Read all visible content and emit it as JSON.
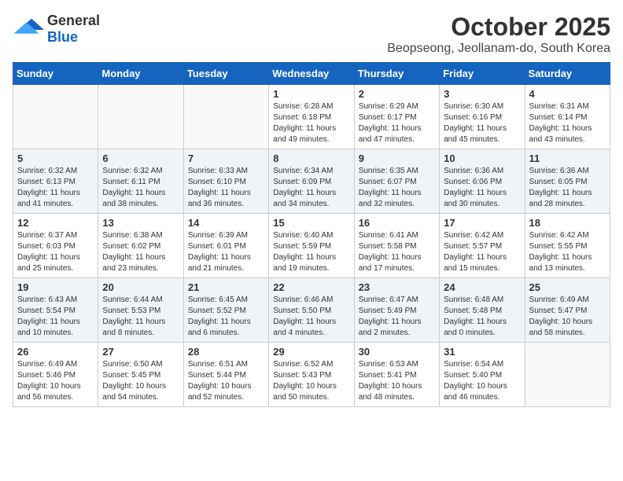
{
  "header": {
    "logo_general": "General",
    "logo_blue": "Blue",
    "month_title": "October 2025",
    "location": "Beopseong, Jeollanam-do, South Korea"
  },
  "days_of_week": [
    "Sunday",
    "Monday",
    "Tuesday",
    "Wednesday",
    "Thursday",
    "Friday",
    "Saturday"
  ],
  "weeks": [
    {
      "shaded": false,
      "days": [
        {
          "number": "",
          "info": ""
        },
        {
          "number": "",
          "info": ""
        },
        {
          "number": "",
          "info": ""
        },
        {
          "number": "1",
          "info": "Sunrise: 6:28 AM\nSunset: 6:18 PM\nDaylight: 11 hours\nand 49 minutes."
        },
        {
          "number": "2",
          "info": "Sunrise: 6:29 AM\nSunset: 6:17 PM\nDaylight: 11 hours\nand 47 minutes."
        },
        {
          "number": "3",
          "info": "Sunrise: 6:30 AM\nSunset: 6:16 PM\nDaylight: 11 hours\nand 45 minutes."
        },
        {
          "number": "4",
          "info": "Sunrise: 6:31 AM\nSunset: 6:14 PM\nDaylight: 11 hours\nand 43 minutes."
        }
      ]
    },
    {
      "shaded": true,
      "days": [
        {
          "number": "5",
          "info": "Sunrise: 6:32 AM\nSunset: 6:13 PM\nDaylight: 11 hours\nand 41 minutes."
        },
        {
          "number": "6",
          "info": "Sunrise: 6:32 AM\nSunset: 6:11 PM\nDaylight: 11 hours\nand 38 minutes."
        },
        {
          "number": "7",
          "info": "Sunrise: 6:33 AM\nSunset: 6:10 PM\nDaylight: 11 hours\nand 36 minutes."
        },
        {
          "number": "8",
          "info": "Sunrise: 6:34 AM\nSunset: 6:09 PM\nDaylight: 11 hours\nand 34 minutes."
        },
        {
          "number": "9",
          "info": "Sunrise: 6:35 AM\nSunset: 6:07 PM\nDaylight: 11 hours\nand 32 minutes."
        },
        {
          "number": "10",
          "info": "Sunrise: 6:36 AM\nSunset: 6:06 PM\nDaylight: 11 hours\nand 30 minutes."
        },
        {
          "number": "11",
          "info": "Sunrise: 6:36 AM\nSunset: 6:05 PM\nDaylight: 11 hours\nand 28 minutes."
        }
      ]
    },
    {
      "shaded": false,
      "days": [
        {
          "number": "12",
          "info": "Sunrise: 6:37 AM\nSunset: 6:03 PM\nDaylight: 11 hours\nand 25 minutes."
        },
        {
          "number": "13",
          "info": "Sunrise: 6:38 AM\nSunset: 6:02 PM\nDaylight: 11 hours\nand 23 minutes."
        },
        {
          "number": "14",
          "info": "Sunrise: 6:39 AM\nSunset: 6:01 PM\nDaylight: 11 hours\nand 21 minutes."
        },
        {
          "number": "15",
          "info": "Sunrise: 6:40 AM\nSunset: 5:59 PM\nDaylight: 11 hours\nand 19 minutes."
        },
        {
          "number": "16",
          "info": "Sunrise: 6:41 AM\nSunset: 5:58 PM\nDaylight: 11 hours\nand 17 minutes."
        },
        {
          "number": "17",
          "info": "Sunrise: 6:42 AM\nSunset: 5:57 PM\nDaylight: 11 hours\nand 15 minutes."
        },
        {
          "number": "18",
          "info": "Sunrise: 6:42 AM\nSunset: 5:55 PM\nDaylight: 11 hours\nand 13 minutes."
        }
      ]
    },
    {
      "shaded": true,
      "days": [
        {
          "number": "19",
          "info": "Sunrise: 6:43 AM\nSunset: 5:54 PM\nDaylight: 11 hours\nand 10 minutes."
        },
        {
          "number": "20",
          "info": "Sunrise: 6:44 AM\nSunset: 5:53 PM\nDaylight: 11 hours\nand 8 minutes."
        },
        {
          "number": "21",
          "info": "Sunrise: 6:45 AM\nSunset: 5:52 PM\nDaylight: 11 hours\nand 6 minutes."
        },
        {
          "number": "22",
          "info": "Sunrise: 6:46 AM\nSunset: 5:50 PM\nDaylight: 11 hours\nand 4 minutes."
        },
        {
          "number": "23",
          "info": "Sunrise: 6:47 AM\nSunset: 5:49 PM\nDaylight: 11 hours\nand 2 minutes."
        },
        {
          "number": "24",
          "info": "Sunrise: 6:48 AM\nSunset: 5:48 PM\nDaylight: 11 hours\nand 0 minutes."
        },
        {
          "number": "25",
          "info": "Sunrise: 6:49 AM\nSunset: 5:47 PM\nDaylight: 10 hours\nand 58 minutes."
        }
      ]
    },
    {
      "shaded": false,
      "days": [
        {
          "number": "26",
          "info": "Sunrise: 6:49 AM\nSunset: 5:46 PM\nDaylight: 10 hours\nand 56 minutes."
        },
        {
          "number": "27",
          "info": "Sunrise: 6:50 AM\nSunset: 5:45 PM\nDaylight: 10 hours\nand 54 minutes."
        },
        {
          "number": "28",
          "info": "Sunrise: 6:51 AM\nSunset: 5:44 PM\nDaylight: 10 hours\nand 52 minutes."
        },
        {
          "number": "29",
          "info": "Sunrise: 6:52 AM\nSunset: 5:43 PM\nDaylight: 10 hours\nand 50 minutes."
        },
        {
          "number": "30",
          "info": "Sunrise: 6:53 AM\nSunset: 5:41 PM\nDaylight: 10 hours\nand 48 minutes."
        },
        {
          "number": "31",
          "info": "Sunrise: 6:54 AM\nSunset: 5:40 PM\nDaylight: 10 hours\nand 46 minutes."
        },
        {
          "number": "",
          "info": ""
        }
      ]
    }
  ]
}
